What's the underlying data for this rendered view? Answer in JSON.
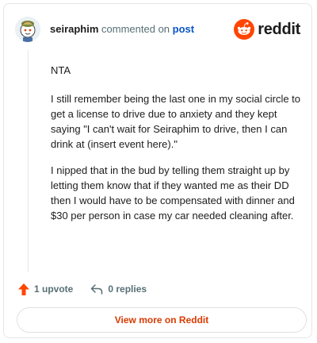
{
  "header": {
    "username": "seiraphim",
    "action_text": "commented on",
    "post_link": "post",
    "brand": "reddit"
  },
  "comment": {
    "paragraphs": [
      "NTA",
      "I still remember being the last one in my social circle to get a license to drive due to anxiety and they kept saying \"I can't wait for Seiraphim to drive, then I can drink at (insert event here).\"",
      "I nipped that in the bud by telling them straight up by letting them know that if they wanted me as their DD then I would have to be compensated with dinner and $30 per person in case my car needed cleaning after."
    ]
  },
  "actions": {
    "upvote_label": "1 upvote",
    "reply_label": "0 replies"
  },
  "footer": {
    "view_more_label": "View more on Reddit"
  },
  "colors": {
    "brand_orange": "#ff4500",
    "link_blue": "#0a55c8",
    "view_more_text": "#d93a00",
    "muted": "#576f76"
  },
  "icons": {
    "avatar": "avatar",
    "brand": "reddit-snoo-icon",
    "upvote": "upvote-arrow-icon",
    "reply": "reply-arrow-icon"
  }
}
